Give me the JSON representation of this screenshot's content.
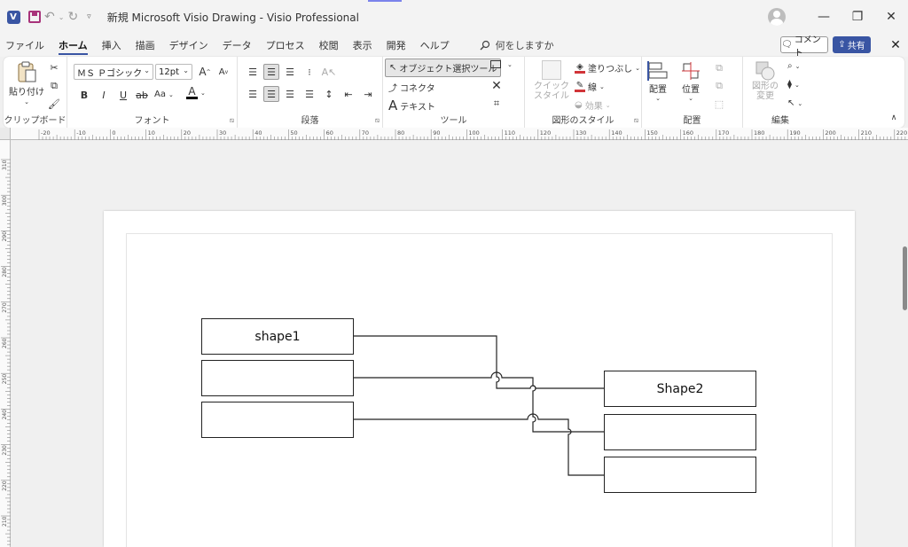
{
  "title_bar": {
    "title": "新規 Microsoft Visio Drawing  -  Visio Professional",
    "app_logo": "V"
  },
  "menu": {
    "tabs": [
      "ファイル",
      "ホーム",
      "挿入",
      "描画",
      "デザイン",
      "データ",
      "プロセス",
      "校閲",
      "表示",
      "開発",
      "ヘルプ"
    ],
    "active_tab": "ホーム",
    "search_placeholder": "何をしますか",
    "comment_label": "コメント",
    "share_label": "共有"
  },
  "ribbon": {
    "clipboard": {
      "label": "クリップボード",
      "paste": "貼り付け"
    },
    "font": {
      "label": "フォント",
      "font_name": "ＭＳ Ｐゴシック",
      "font_size": "12pt",
      "bold": "B",
      "italic": "I",
      "underline": "U",
      "strike": "ab",
      "case": "Aa",
      "grow": "A",
      "shrink": "A",
      "color": "A"
    },
    "paragraph": {
      "label": "段落"
    },
    "tools": {
      "label": "ツール",
      "pointer": "オブジェクト選択ツール",
      "connector": "コネクタ",
      "text": "テキスト"
    },
    "shape_styles": {
      "label": "図形のスタイル",
      "quick_styles_line1": "クイック",
      "quick_styles_line2": "スタイル",
      "fill": "塗りつぶし",
      "line": "線",
      "effects": "効果"
    },
    "arrange": {
      "label": "配置",
      "align": "配置",
      "position": "位置"
    },
    "editing": {
      "label": "編集",
      "change_shape_line1": "図形の",
      "change_shape_line2": "変更"
    }
  },
  "rulers": {
    "h_ticks": [
      "-20",
      "-10",
      "0",
      "10",
      "20",
      "30",
      "40",
      "50",
      "60",
      "70",
      "80",
      "90",
      "100",
      "110",
      "120",
      "130",
      "140",
      "150",
      "160",
      "170",
      "180",
      "190",
      "200",
      "210",
      "220"
    ],
    "v_ticks": [
      "310",
      "300",
      "290",
      "280",
      "270",
      "260",
      "250",
      "240",
      "230",
      "220",
      "210"
    ]
  },
  "diagram": {
    "shapes": [
      {
        "id": "shape1",
        "text": "shape1"
      },
      {
        "id": "left2",
        "text": ""
      },
      {
        "id": "left3",
        "text": ""
      },
      {
        "id": "shape2",
        "text": "Shape2"
      },
      {
        "id": "right2",
        "text": ""
      },
      {
        "id": "right3",
        "text": ""
      }
    ]
  },
  "colors": {
    "accent": "#3955a3",
    "line_red": "#d13438",
    "connector": "#222222"
  }
}
